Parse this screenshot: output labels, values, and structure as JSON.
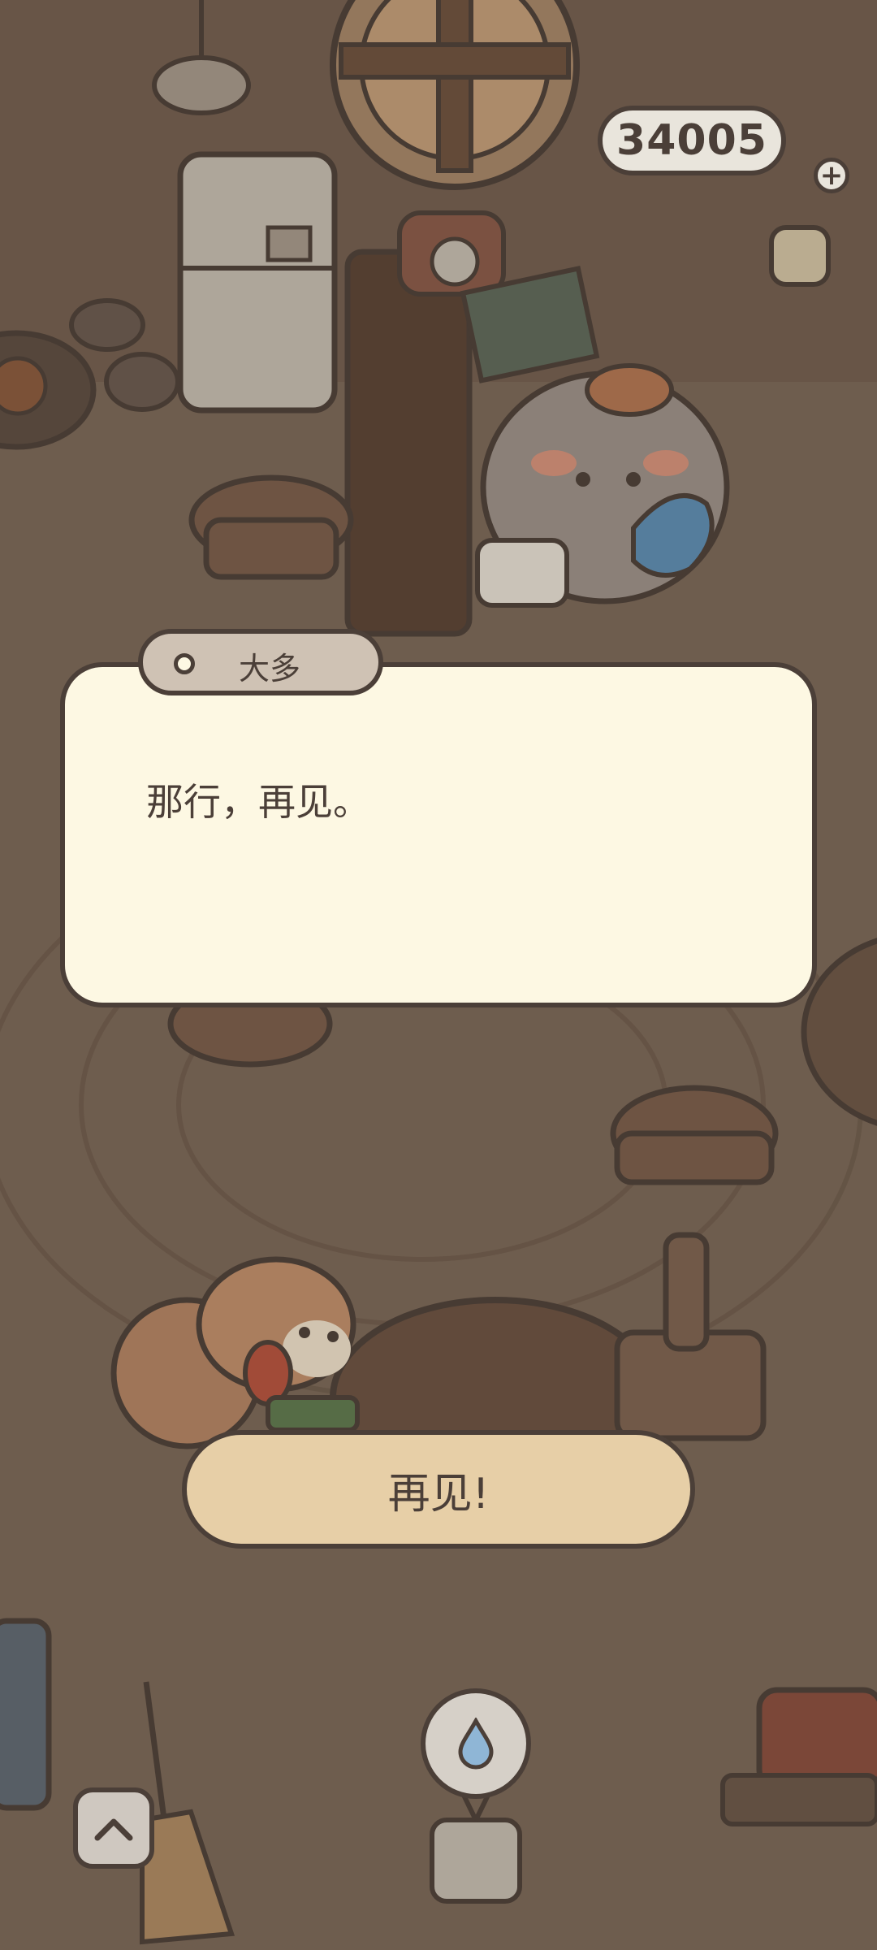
{
  "hud": {
    "currency_value": "34005",
    "currency_plus": "+"
  },
  "dialog": {
    "speaker_name": "大多",
    "text": "那行，再见。"
  },
  "reply": {
    "label": "再见!"
  },
  "icons": {
    "up_button": "chevron-up-icon",
    "water_need": "water-drop-icon"
  },
  "colors": {
    "outline": "#4b3f38",
    "dialog_bg": "#fdf8e3",
    "button_bg": "#e7cfa7",
    "name_tag_bg": "#cfc2b4"
  }
}
